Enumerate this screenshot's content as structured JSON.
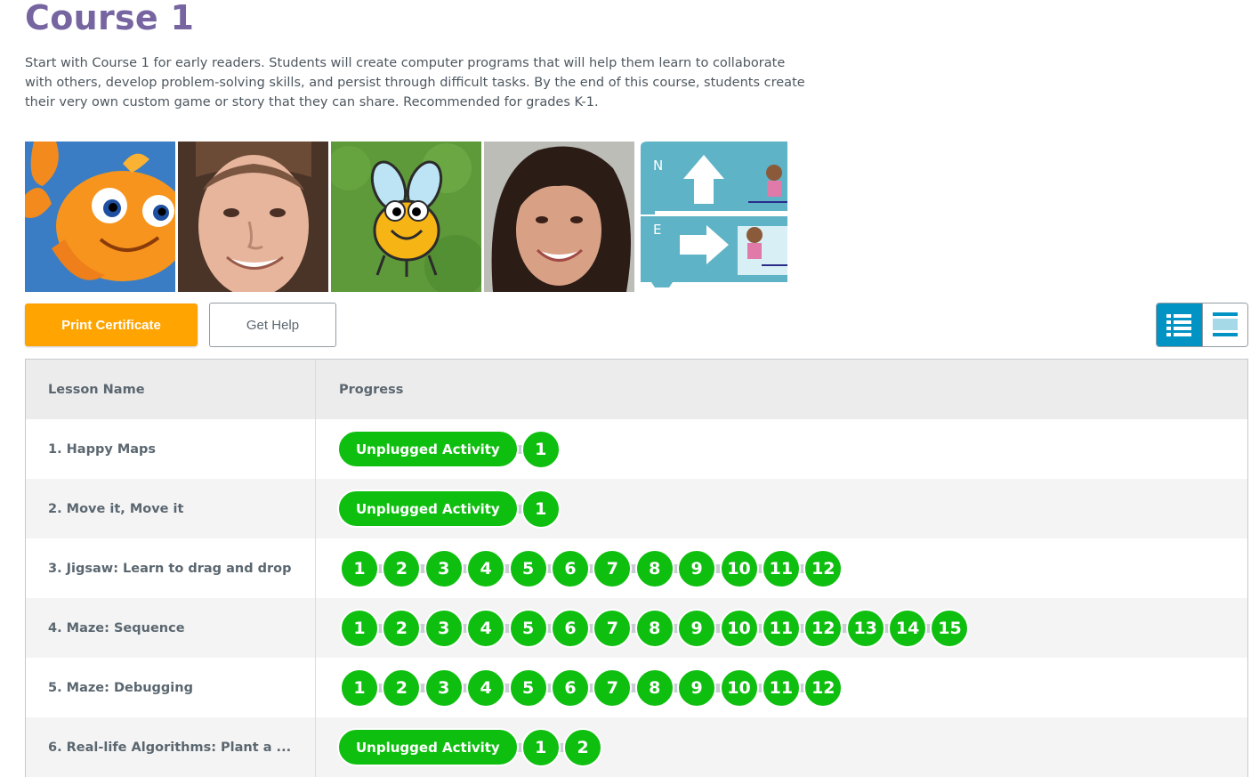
{
  "course": {
    "title": "Course 1",
    "description": "Start with Course 1 for early readers. Students will create computer programs that will help them learn to collaborate with others, develop problem-solving skills, and persist through difficult tasks. By the end of this course, students create their very own custom game or story that they can share. Recommended for grades K-1."
  },
  "images": [
    {
      "name": "flappy-fish-image"
    },
    {
      "name": "presenter-man-image"
    },
    {
      "name": "bee-character-image"
    },
    {
      "name": "presenter-woman-image"
    },
    {
      "name": "unplugged-arrows-image",
      "labels": [
        "N",
        "E"
      ]
    }
  ],
  "actions": {
    "print_label": "Print Certificate",
    "help_label": "Get Help",
    "view_toggle": {
      "selected": "detail-view",
      "options": [
        "detail-view",
        "summary-view"
      ]
    }
  },
  "colors": {
    "accent_purple": "#7665a0",
    "print_orange": "#ffa400",
    "complete_green": "#0fbf10",
    "toggle_blue": "#0093c4"
  },
  "table": {
    "headers": {
      "lesson": "Lesson Name",
      "progress": "Progress"
    },
    "lessons": [
      {
        "name": "1. Happy Maps",
        "unplugged": "Unplugged Activity",
        "levels": [
          "1"
        ]
      },
      {
        "name": "2. Move it, Move it",
        "unplugged": "Unplugged Activity",
        "levels": [
          "1"
        ]
      },
      {
        "name": "3. Jigsaw: Learn to drag and drop",
        "unplugged": null,
        "levels": [
          "1",
          "2",
          "3",
          "4",
          "5",
          "6",
          "7",
          "8",
          "9",
          "10",
          "11",
          "12"
        ]
      },
      {
        "name": "4. Maze: Sequence",
        "unplugged": null,
        "levels": [
          "1",
          "2",
          "3",
          "4",
          "5",
          "6",
          "7",
          "8",
          "9",
          "10",
          "11",
          "12",
          "13",
          "14",
          "15"
        ]
      },
      {
        "name": "5. Maze: Debugging",
        "unplugged": null,
        "levels": [
          "1",
          "2",
          "3",
          "4",
          "5",
          "6",
          "7",
          "8",
          "9",
          "10",
          "11",
          "12"
        ]
      },
      {
        "name": "6. Real-life Algorithms: Plant a ...",
        "unplugged": "Unplugged Activity",
        "levels": [
          "1",
          "2"
        ]
      }
    ]
  }
}
